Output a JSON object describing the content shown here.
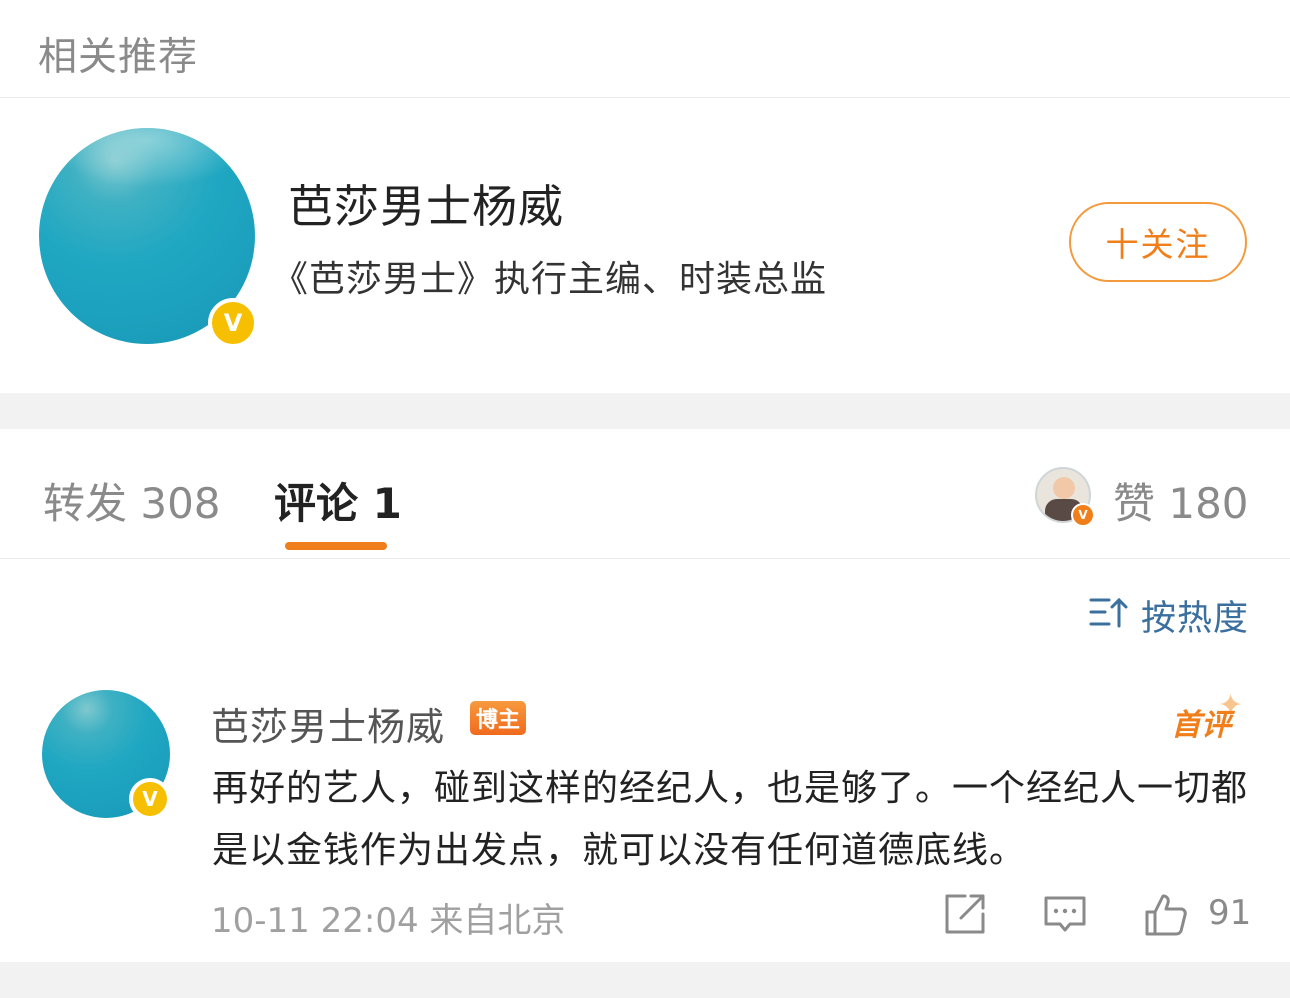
{
  "section": {
    "title": "相关推荐"
  },
  "recommended": {
    "name": "芭莎男士杨威",
    "description": "《芭莎男士》执行主编、时装总监",
    "verified_badge": "V",
    "follow_label": "十关注",
    "accent_color": "#f07f1b"
  },
  "tabs": {
    "repost": "转发 308",
    "comment": "评论 1",
    "likes": "赞 180"
  },
  "sort": {
    "label": "按热度",
    "icon": "sort-icon"
  },
  "comment": {
    "author": "芭莎男士杨威",
    "author_tag": "博主",
    "first_label": "首评",
    "text": "再好的艺人，碰到这样的经纪人，也是够了。一个经纪人一切都是以金钱作为出发点，就可以没有任何道德底线。",
    "meta": "10-11 22:04 来自北京",
    "like_count": "91",
    "verified_badge": "V"
  }
}
